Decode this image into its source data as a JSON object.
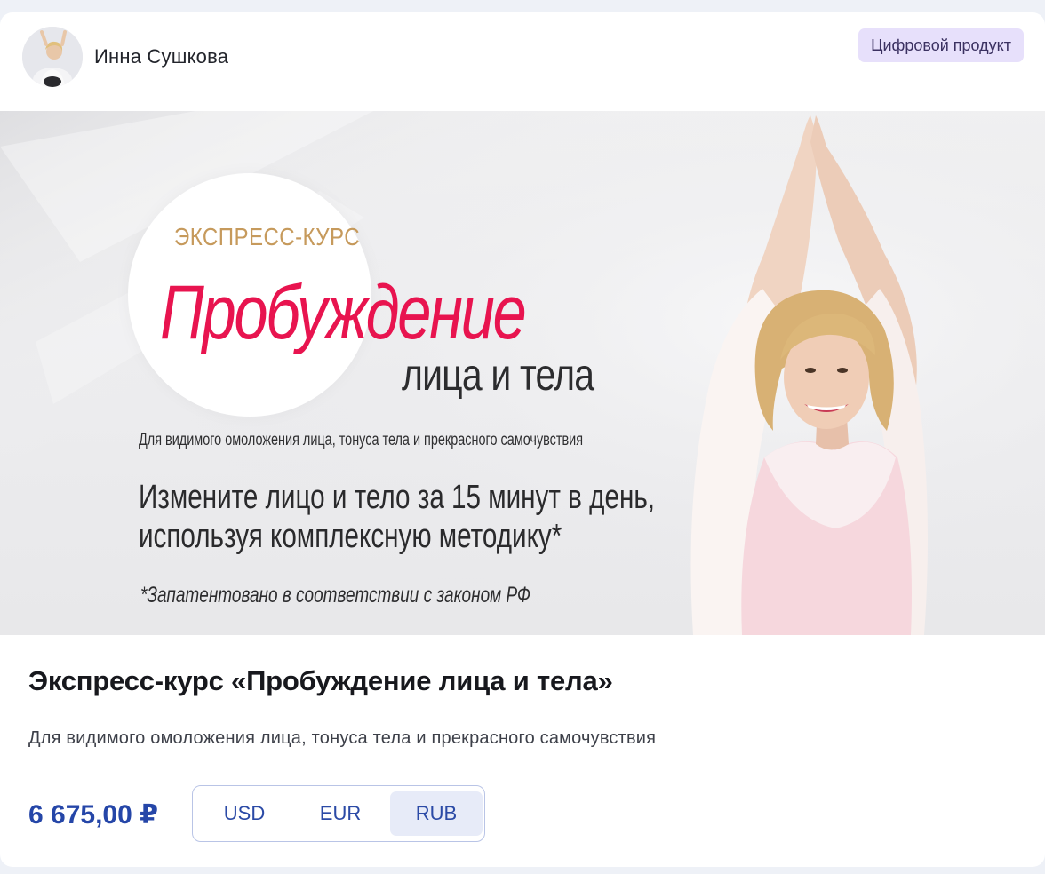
{
  "header": {
    "author_name": "Инна Сушкова",
    "badge": "Цифровой продукт"
  },
  "banner": {
    "kicker": "ЭКСПРЕСС-КУРС",
    "title": "Пробуждение",
    "title_line2": "лица и тела",
    "subtitle": "Для видимого омоложения лица, тонуса тела и прекрасного самочувствия",
    "headline_line1": "Измените лицо и тело за 15 минут в день,",
    "headline_line2": "используя комплексную методику*",
    "note": "*Запатентовано в соответствии с законом РФ",
    "colors": {
      "title": "#e8144f",
      "kicker": "#c69a5c"
    }
  },
  "product": {
    "title": "Экспресс-курс «Пробуждение лица и тела»",
    "description": "Для видимого омоложения лица, тонуса тела и прекрасного самочувствия",
    "price": "6 675,00 ₽"
  },
  "currency_switch": {
    "options": [
      "USD",
      "EUR",
      "RUB"
    ],
    "selected": "RUB"
  },
  "colors": {
    "accent": "#2546a8",
    "badge_bg": "#e7e0fb",
    "page_bg": "#eef1f7"
  }
}
